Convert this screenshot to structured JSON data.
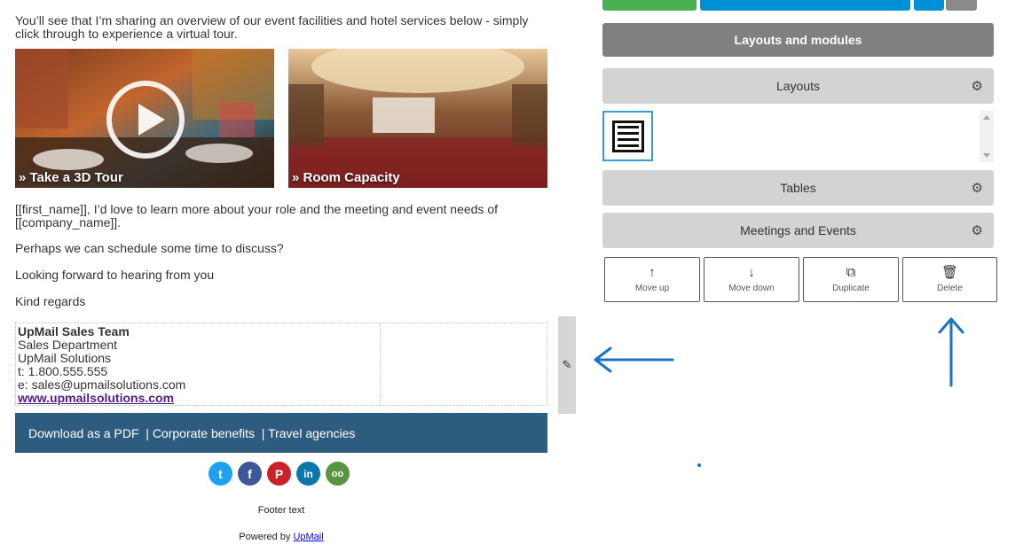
{
  "email": {
    "intro": "You’ll see that I’m sharing an overview of our event facilities and hotel services below - simply click through to experience a virtual tour.",
    "tiles": [
      {
        "caption": "» Take a 3D Tour"
      },
      {
        "caption": "» Room Capacity"
      }
    ],
    "paragraphs": [
      "[[first_name]], I’d love to learn more about your role and the meeting and event needs of [[company_name]].",
      "Perhaps we can schedule some time to discuss?",
      "Looking forward to hearing from you",
      "Kind regards"
    ],
    "signature": {
      "name": "UpMail Sales Team",
      "department": "Sales Department",
      "company": "UpMail Solutions",
      "phone": "t: 1.800.555.555",
      "email": "e: sales@upmailsolutions.com",
      "website": "www.upmailsolutions.com"
    },
    "footer_links": [
      "Download as a PDF",
      "| Corporate benefits",
      "| Travel agencies"
    ],
    "social": [
      {
        "name": "twitter",
        "glyph": "t",
        "color": "#1da1f2"
      },
      {
        "name": "facebook",
        "glyph": "f",
        "color": "#3b5998"
      },
      {
        "name": "pinterest",
        "glyph": "P",
        "color": "#cb2027"
      },
      {
        "name": "linkedin",
        "glyph": "in",
        "color": "#0e76a8"
      },
      {
        "name": "tripadvisor",
        "glyph": "oo",
        "color": "#589442"
      }
    ],
    "footer_text": "Footer text",
    "powered_prefix": "Powered by",
    "powered_link": "UpMail"
  },
  "builder": {
    "header": "Layouts and modules",
    "sections": {
      "layouts": "Layouts",
      "tables": "Tables",
      "meetings": "Meetings and Events"
    },
    "actions": [
      {
        "icon": "arrow-up-icon",
        "glyph": "↑",
        "label": "Move up"
      },
      {
        "icon": "arrow-down-icon",
        "glyph": "↓",
        "label": "Move down"
      },
      {
        "icon": "duplicate-icon",
        "glyph": "⧉",
        "label": "Duplicate"
      },
      {
        "icon": "trash-icon",
        "glyph": "🗑",
        "label": "Delete"
      }
    ]
  },
  "colors": {
    "accent_blue": "#0091d5",
    "send_green": "#4caf50",
    "footer_bar": "#2e5c7e",
    "annotation_arrow": "#1a73c8"
  }
}
